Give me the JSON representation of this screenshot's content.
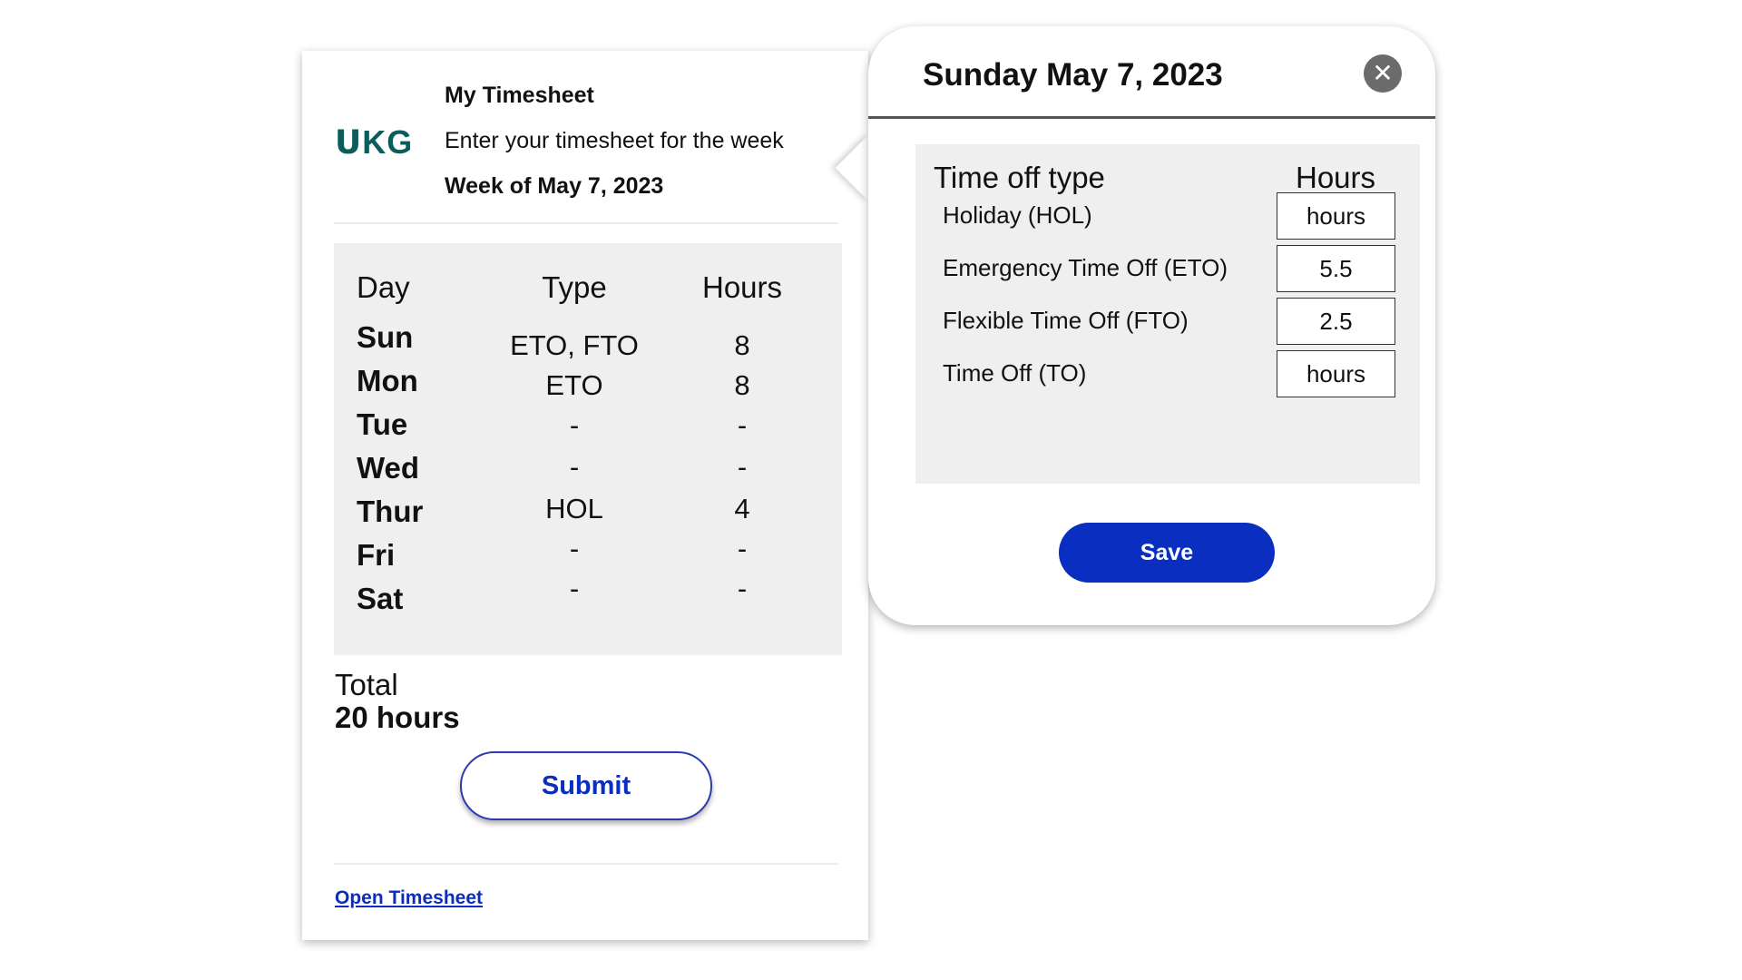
{
  "timesheet": {
    "logo_text": "ᑌKG",
    "title": "My Timesheet",
    "subtitle": "Enter your timesheet for the week",
    "week": "Week of May 7, 2023",
    "columns": {
      "day": "Day",
      "type": "Type",
      "hours": "Hours"
    },
    "rows": [
      {
        "day": "Sun",
        "type": "ETO, FTO",
        "hours": "8"
      },
      {
        "day": "Mon",
        "type": "ETO",
        "hours": "8"
      },
      {
        "day": "Tue",
        "type": "-",
        "hours": "-"
      },
      {
        "day": "Wed",
        "type": "-",
        "hours": "-"
      },
      {
        "day": "Thur",
        "type": "HOL",
        "hours": "4"
      },
      {
        "day": "Fri",
        "type": "-",
        "hours": "-"
      },
      {
        "day": "Sat",
        "type": "-",
        "hours": "-"
      }
    ],
    "total_label": "Total",
    "total_value": "20 hours",
    "submit_label": "Submit",
    "open_link": "Open Timesheet"
  },
  "popover": {
    "title": "Sunday May 7, 2023",
    "close_symbol": "✕",
    "columns": {
      "type": "Time off type",
      "hours": "Hours"
    },
    "rows": [
      {
        "label": "Holiday (HOL)",
        "value": "",
        "placeholder": "hours"
      },
      {
        "label": "Emergency Time Off (ETO)",
        "value": "5.5",
        "placeholder": "hours"
      },
      {
        "label": "Flexible Time Off (FTO)",
        "value": "2.5",
        "placeholder": "hours"
      },
      {
        "label": "Time Off (TO)",
        "value": "",
        "placeholder": "hours"
      }
    ],
    "save_label": "Save"
  },
  "colors": {
    "brand": "#0b5d5b",
    "primary": "#0a2ec0",
    "panel": "#efefef",
    "close": "#6b6b6b"
  },
  "icons": {
    "close": "close-icon"
  }
}
